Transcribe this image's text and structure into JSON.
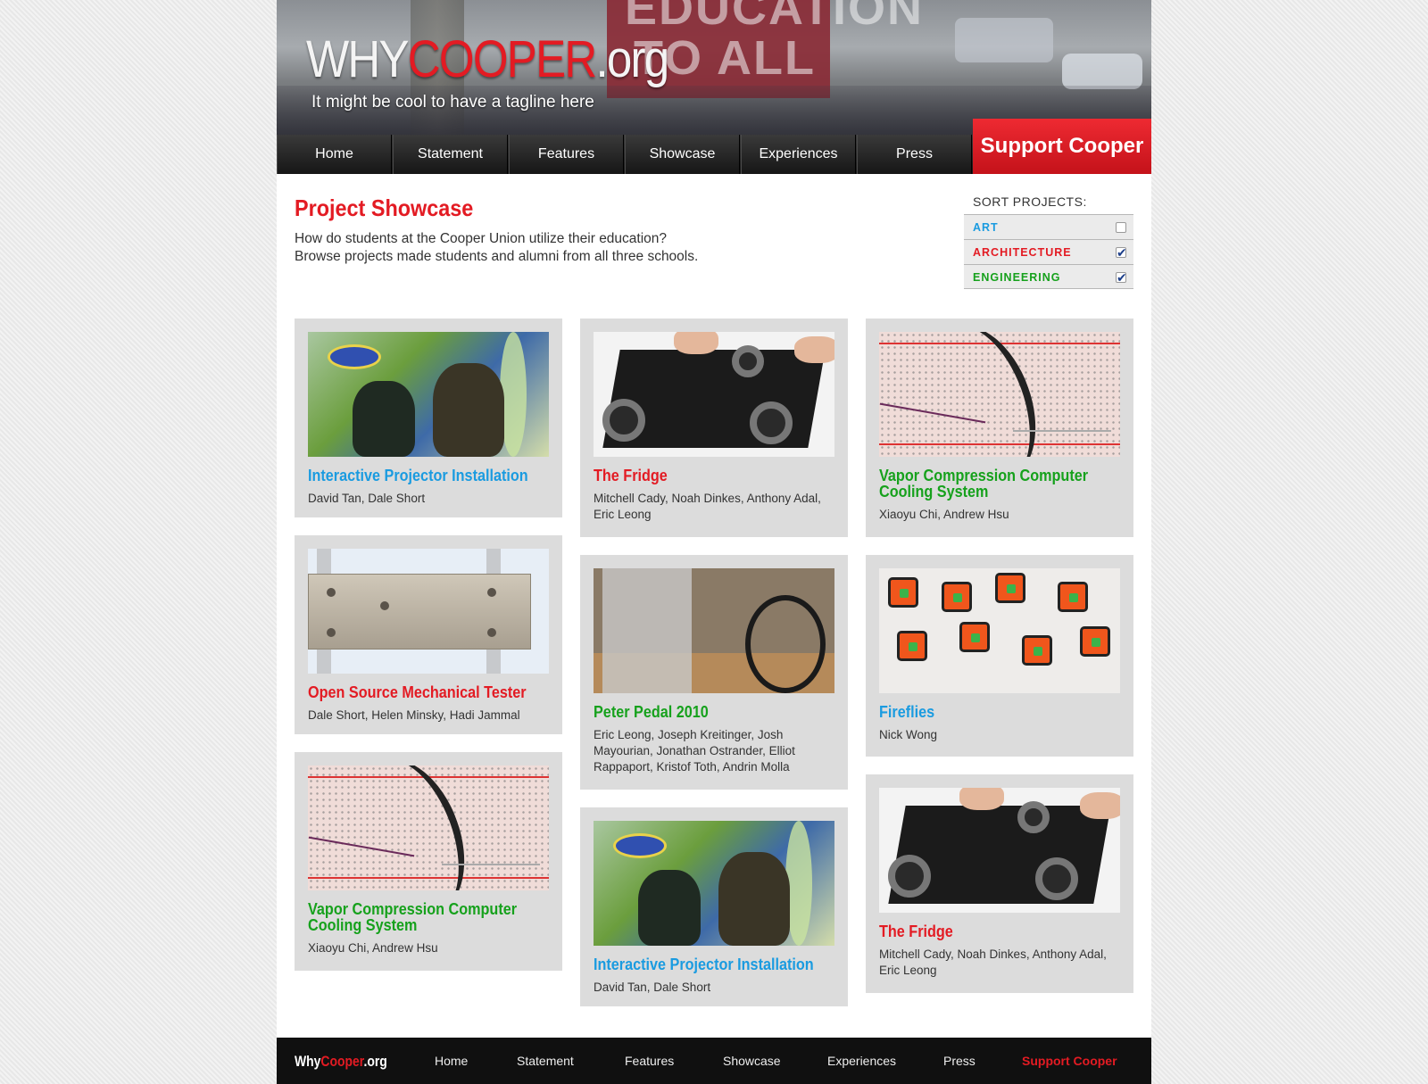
{
  "header": {
    "logo": {
      "why": "WHY",
      "cooper": "COOPER",
      "org": ".org"
    },
    "banner_line1": "EDUCATION",
    "banner_line2": "TO ALL",
    "tagline": "It might be cool to have a tagline here"
  },
  "nav": {
    "items": [
      "Home",
      "Statement",
      "Features",
      "Showcase",
      "Experiences",
      "Press"
    ],
    "support": "Support Cooper"
  },
  "intro": {
    "title": "Project Showcase",
    "line1": "How do students at the Cooper Union utilize their education?",
    "line2": "Browse projects made students and alumni from all three schools."
  },
  "sort": {
    "label": "SORT PROJECTS:",
    "options": [
      {
        "label": "ART",
        "color": "#1a9be0",
        "checked": false
      },
      {
        "label": "ARCHITECTURE",
        "color": "#e31b23",
        "checked": true
      },
      {
        "label": "ENGINEERING",
        "color": "#16a11c",
        "checked": true
      }
    ]
  },
  "colors": {
    "art": "#1a9be0",
    "architecture": "#e31b23",
    "engineering": "#16a11c"
  },
  "cards": [
    {
      "title": "Interactive Projector Installation",
      "authors": "David Tan, Dale Short"
    },
    {
      "title": "The Fridge",
      "authors": "Mitchell Cady, Noah Dinkes, Anthony Adal, Eric Leong"
    },
    {
      "title": "Vapor Compression Computer Cooling System",
      "authors": "Xiaoyu Chi, Andrew Hsu"
    },
    {
      "title": "Open Source Mechanical Tester",
      "authors": "Dale Short, Helen Minsky, Hadi Jammal"
    },
    {
      "title": "Peter Pedal 2010",
      "authors": "Eric Leong, Joseph Kreitinger, Josh Mayourian, Jonathan Ostrander, Elliot Rappaport, Kristof Toth, Andrin Molla"
    },
    {
      "title": "Fireflies",
      "authors": "Nick Wong"
    },
    {
      "title": "Vapor Compression Computer Cooling System",
      "authors": "Xiaoyu Chi, Andrew Hsu"
    },
    {
      "title": "Interactive Projector Installation",
      "authors": "David Tan, Dale Short"
    },
    {
      "title": "The Fridge",
      "authors": "Mitchell Cady, Noah Dinkes, Anthony Adal, Eric Leong"
    }
  ],
  "footer": {
    "logo": {
      "why": "Why",
      "cooper": "Cooper",
      "org": ".org"
    },
    "links": [
      "Home",
      "Statement",
      "Features",
      "Showcase",
      "Experiences",
      "Press"
    ],
    "support": "Support Cooper"
  }
}
